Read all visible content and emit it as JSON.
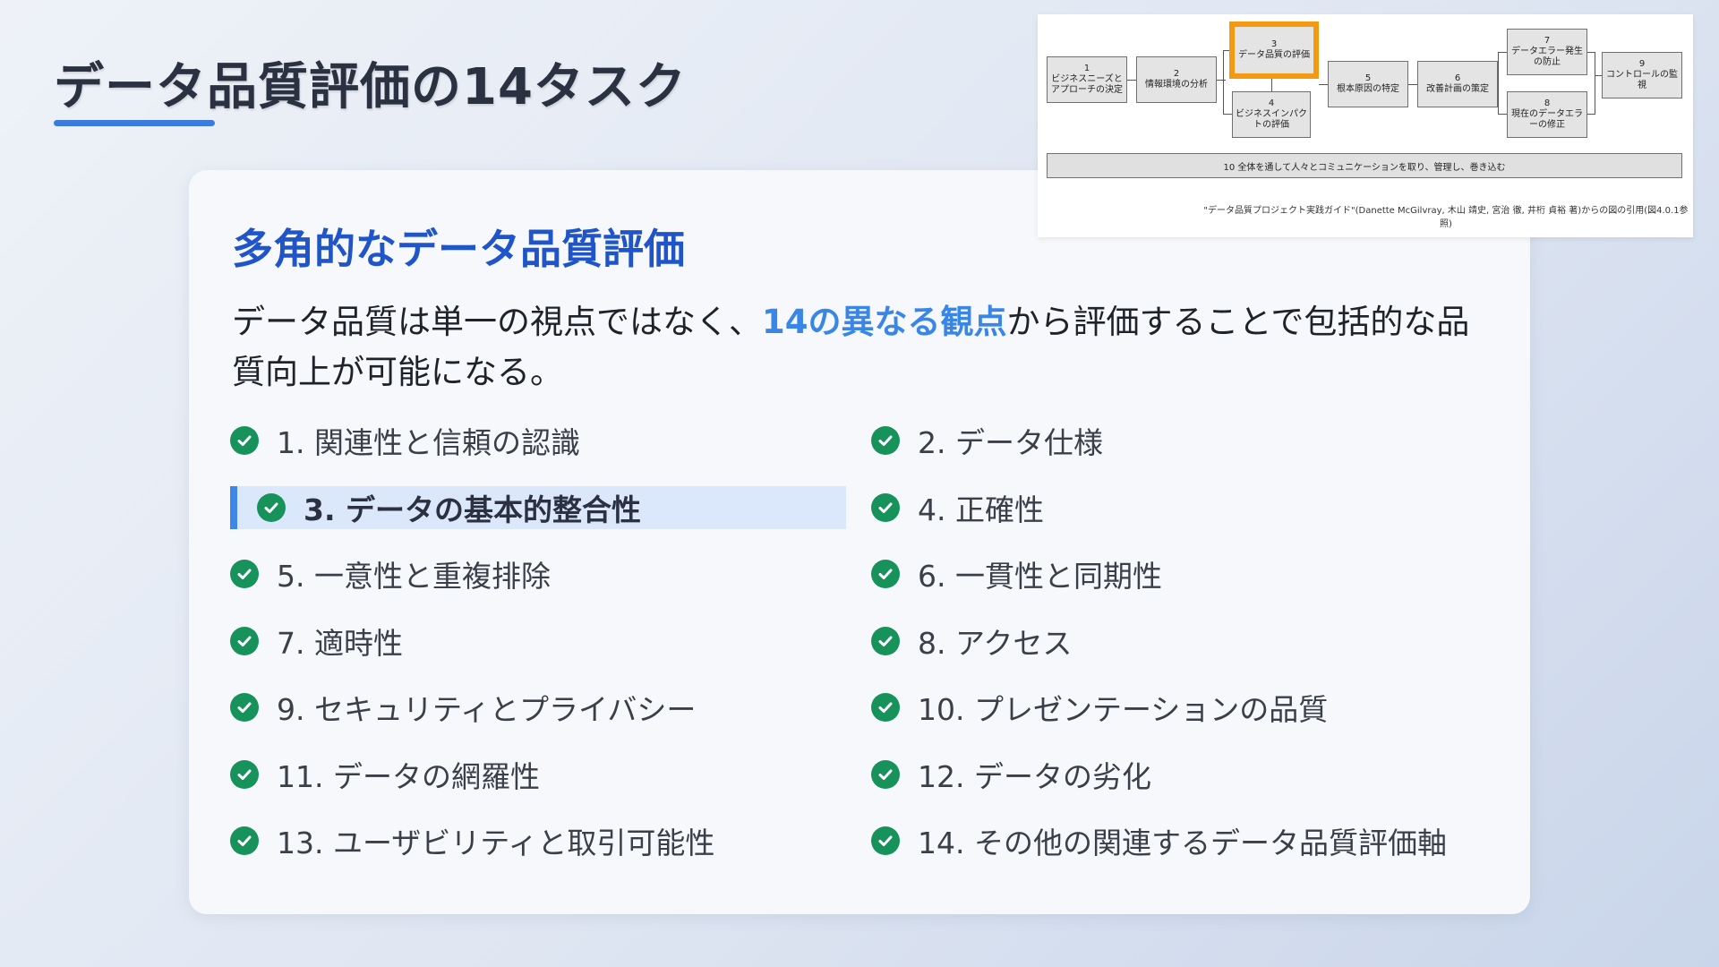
{
  "slide": {
    "title": "データ品質評価の14タスク"
  },
  "card": {
    "heading": "多角的なデータ品質評価",
    "desc_before": "データ品質は単一の視点ではなく、",
    "desc_highlight": "14の異なる観点",
    "desc_after": "から評価することで包括的な品質向上が可能になる。"
  },
  "items": [
    {
      "label": "1. 関連性と信頼の認識"
    },
    {
      "label": "2. データ仕様"
    },
    {
      "label": "3. データの基本的整合性",
      "active": true
    },
    {
      "label": "4. 正確性"
    },
    {
      "label": "5. 一意性と重複排除"
    },
    {
      "label": "6. 一貫性と同期性"
    },
    {
      "label": "7. 適時性"
    },
    {
      "label": "8. アクセス"
    },
    {
      "label": "9. セキュリティとプライバシー"
    },
    {
      "label": "10. プレゼンテーションの品質"
    },
    {
      "label": "11. データの網羅性"
    },
    {
      "label": "12. データの劣化"
    },
    {
      "label": "13. ユーザビリティと取引可能性"
    },
    {
      "label": "14. その他の関連するデータ品質評価軸"
    }
  ],
  "diagram": {
    "steps": {
      "s1": "1\nビジネスニーズとアプローチの決定",
      "s2": "2\n情報環境の分析",
      "s3": "3\nデータ品質の評価",
      "s4": "4\nビジネスインパクトの評価",
      "s5": "5\n根本原因の特定",
      "s6": "6\n改善計画の策定",
      "s7": "7\nデータエラー発生の防止",
      "s8": "8\n現在のデータエラーの修正",
      "s9": "9\nコントロールの監視"
    },
    "bar": "10 全体を通して人々とコミュニケーションを取り、管理し、巻き込む",
    "caption": "\"データ品質プロジェクト実践ガイド\"(Danette McGilvray, 木山 靖史, 宮治 徹, 井桁 貞裕 著)からの図の引用(図4.0.1参照)"
  },
  "colors": {
    "accent": "#1f55c9",
    "highlight": "#3a86e6",
    "check": "#16925a",
    "active_bg": "#dbe8fb",
    "diagram_highlight": "#f29a11"
  }
}
